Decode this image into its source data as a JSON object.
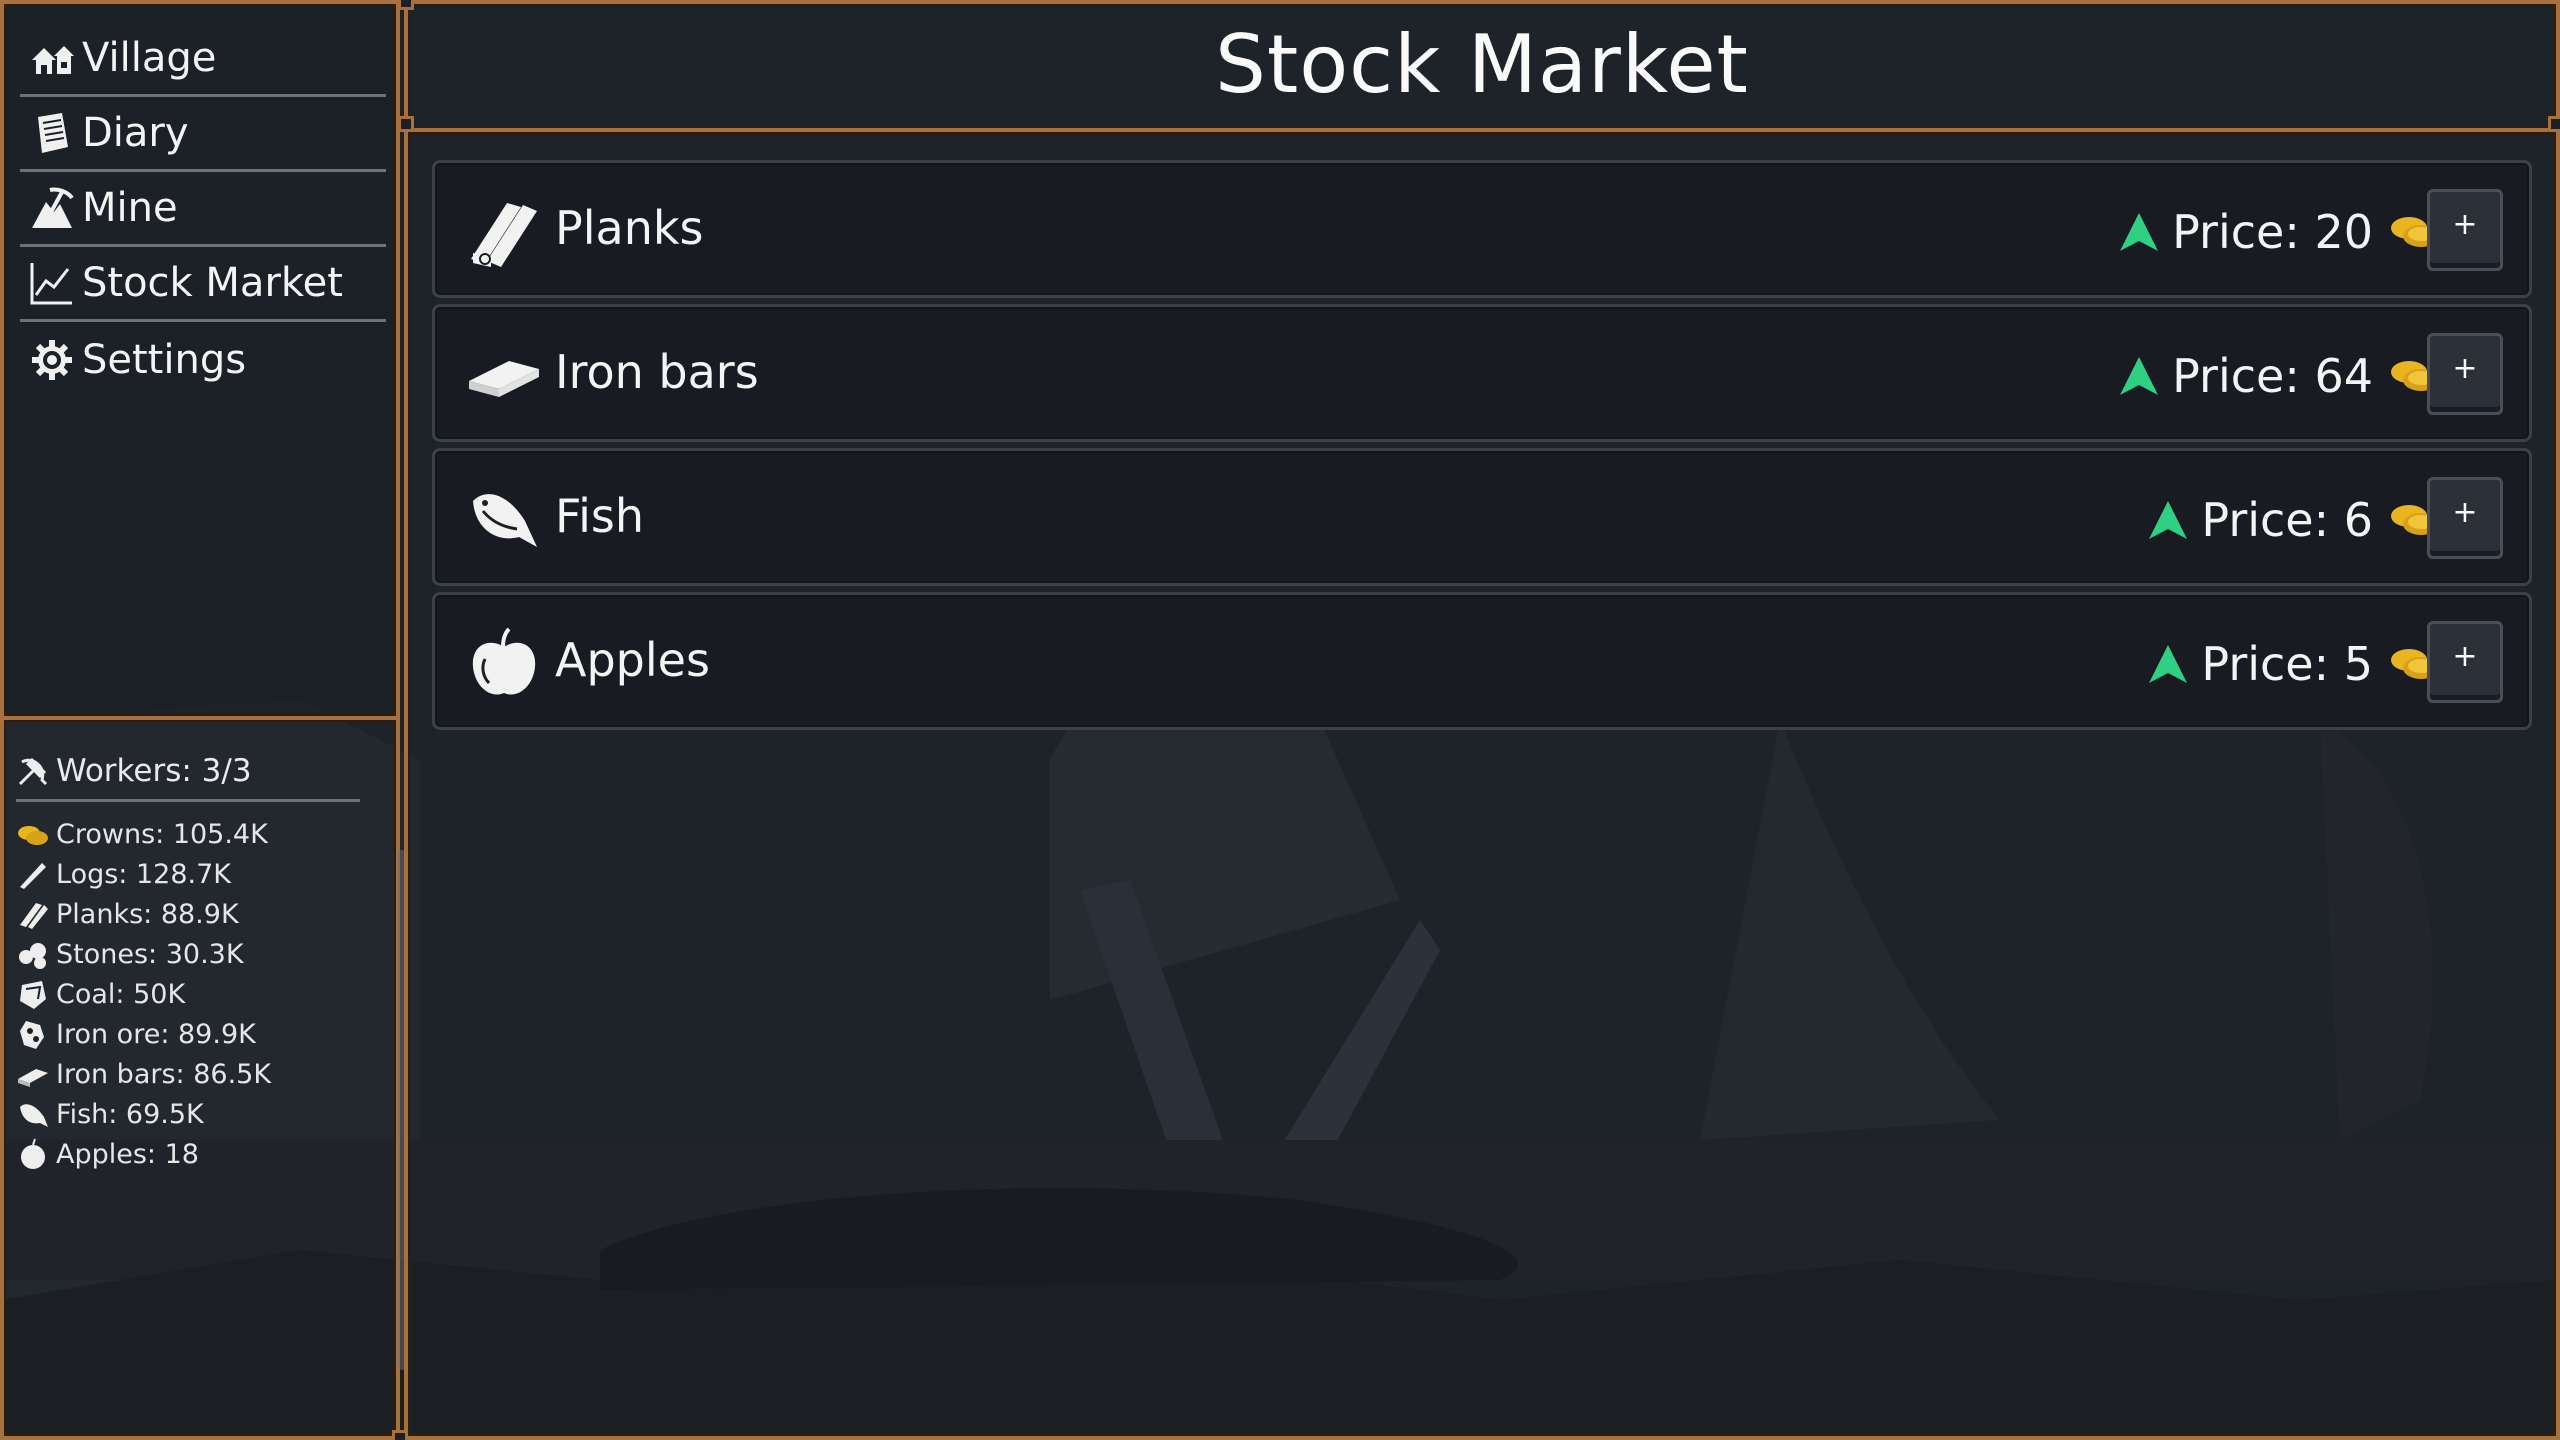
{
  "page": {
    "title": "Stock Market"
  },
  "sidebar": {
    "items": [
      {
        "label": "Village",
        "icon": "village-icon"
      },
      {
        "label": "Diary",
        "icon": "diary-icon"
      },
      {
        "label": "Mine",
        "icon": "mine-icon"
      },
      {
        "label": "Stock Market",
        "icon": "chart-icon"
      },
      {
        "label": "Settings",
        "icon": "gear-icon"
      }
    ]
  },
  "resources": {
    "workers": "Workers: 3/3",
    "items": [
      {
        "label": "Crowns: 105.4K",
        "icon": "coins-icon"
      },
      {
        "label": "Logs: 128.7K",
        "icon": "log-icon"
      },
      {
        "label": "Planks: 88.9K",
        "icon": "planks-icon"
      },
      {
        "label": "Stones: 30.3K",
        "icon": "stones-icon"
      },
      {
        "label": "Coal: 50K",
        "icon": "coal-icon"
      },
      {
        "label": "Iron ore: 89.9K",
        "icon": "iron-ore-icon"
      },
      {
        "label": "Iron bars: 86.5K",
        "icon": "iron-bar-icon"
      },
      {
        "label": "Fish: 69.5K",
        "icon": "fish-icon"
      },
      {
        "label": "Apples: 18",
        "icon": "apple-icon"
      }
    ]
  },
  "market": {
    "rows": [
      {
        "name": "Planks",
        "price": "Price: 20",
        "trend": "up",
        "icon": "planks-icon",
        "button": "+"
      },
      {
        "name": "Iron bars",
        "price": "Price: 64",
        "trend": "up",
        "icon": "iron-bar-icon",
        "button": "+"
      },
      {
        "name": "Fish",
        "price": "Price: 6",
        "trend": "up",
        "icon": "fish-icon",
        "button": "+"
      },
      {
        "name": "Apples",
        "price": "Price: 5",
        "trend": "up",
        "icon": "apple-icon",
        "button": "+"
      }
    ]
  },
  "colors": {
    "frame": "#a8703b",
    "background": "#1c2026",
    "trend_up": "#2fcf84",
    "coin": "#e8b520"
  }
}
